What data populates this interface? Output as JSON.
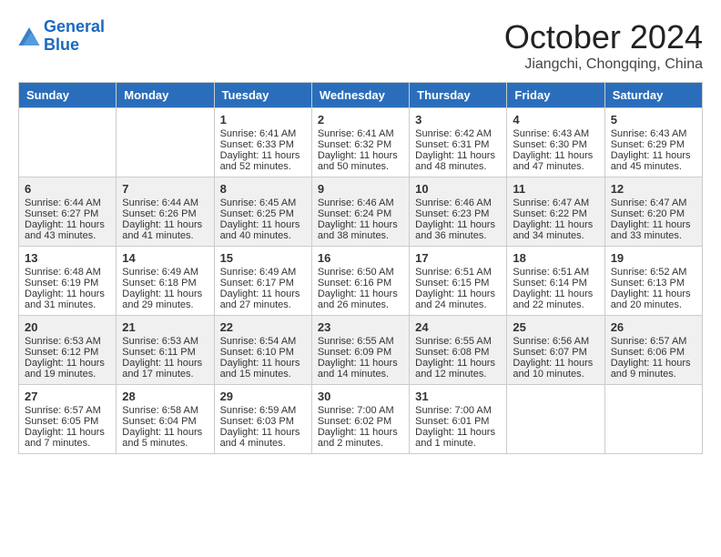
{
  "logo": {
    "line1": "General",
    "line2": "Blue"
  },
  "title": "October 2024",
  "location": "Jiangchi, Chongqing, China",
  "weekdays": [
    "Sunday",
    "Monday",
    "Tuesday",
    "Wednesday",
    "Thursday",
    "Friday",
    "Saturday"
  ],
  "weeks": [
    [
      {
        "day": "",
        "sunrise": "",
        "sunset": "",
        "daylight": ""
      },
      {
        "day": "",
        "sunrise": "",
        "sunset": "",
        "daylight": ""
      },
      {
        "day": "1",
        "sunrise": "Sunrise: 6:41 AM",
        "sunset": "Sunset: 6:33 PM",
        "daylight": "Daylight: 11 hours and 52 minutes."
      },
      {
        "day": "2",
        "sunrise": "Sunrise: 6:41 AM",
        "sunset": "Sunset: 6:32 PM",
        "daylight": "Daylight: 11 hours and 50 minutes."
      },
      {
        "day": "3",
        "sunrise": "Sunrise: 6:42 AM",
        "sunset": "Sunset: 6:31 PM",
        "daylight": "Daylight: 11 hours and 48 minutes."
      },
      {
        "day": "4",
        "sunrise": "Sunrise: 6:43 AM",
        "sunset": "Sunset: 6:30 PM",
        "daylight": "Daylight: 11 hours and 47 minutes."
      },
      {
        "day": "5",
        "sunrise": "Sunrise: 6:43 AM",
        "sunset": "Sunset: 6:29 PM",
        "daylight": "Daylight: 11 hours and 45 minutes."
      }
    ],
    [
      {
        "day": "6",
        "sunrise": "Sunrise: 6:44 AM",
        "sunset": "Sunset: 6:27 PM",
        "daylight": "Daylight: 11 hours and 43 minutes."
      },
      {
        "day": "7",
        "sunrise": "Sunrise: 6:44 AM",
        "sunset": "Sunset: 6:26 PM",
        "daylight": "Daylight: 11 hours and 41 minutes."
      },
      {
        "day": "8",
        "sunrise": "Sunrise: 6:45 AM",
        "sunset": "Sunset: 6:25 PM",
        "daylight": "Daylight: 11 hours and 40 minutes."
      },
      {
        "day": "9",
        "sunrise": "Sunrise: 6:46 AM",
        "sunset": "Sunset: 6:24 PM",
        "daylight": "Daylight: 11 hours and 38 minutes."
      },
      {
        "day": "10",
        "sunrise": "Sunrise: 6:46 AM",
        "sunset": "Sunset: 6:23 PM",
        "daylight": "Daylight: 11 hours and 36 minutes."
      },
      {
        "day": "11",
        "sunrise": "Sunrise: 6:47 AM",
        "sunset": "Sunset: 6:22 PM",
        "daylight": "Daylight: 11 hours and 34 minutes."
      },
      {
        "day": "12",
        "sunrise": "Sunrise: 6:47 AM",
        "sunset": "Sunset: 6:20 PM",
        "daylight": "Daylight: 11 hours and 33 minutes."
      }
    ],
    [
      {
        "day": "13",
        "sunrise": "Sunrise: 6:48 AM",
        "sunset": "Sunset: 6:19 PM",
        "daylight": "Daylight: 11 hours and 31 minutes."
      },
      {
        "day": "14",
        "sunrise": "Sunrise: 6:49 AM",
        "sunset": "Sunset: 6:18 PM",
        "daylight": "Daylight: 11 hours and 29 minutes."
      },
      {
        "day": "15",
        "sunrise": "Sunrise: 6:49 AM",
        "sunset": "Sunset: 6:17 PM",
        "daylight": "Daylight: 11 hours and 27 minutes."
      },
      {
        "day": "16",
        "sunrise": "Sunrise: 6:50 AM",
        "sunset": "Sunset: 6:16 PM",
        "daylight": "Daylight: 11 hours and 26 minutes."
      },
      {
        "day": "17",
        "sunrise": "Sunrise: 6:51 AM",
        "sunset": "Sunset: 6:15 PM",
        "daylight": "Daylight: 11 hours and 24 minutes."
      },
      {
        "day": "18",
        "sunrise": "Sunrise: 6:51 AM",
        "sunset": "Sunset: 6:14 PM",
        "daylight": "Daylight: 11 hours and 22 minutes."
      },
      {
        "day": "19",
        "sunrise": "Sunrise: 6:52 AM",
        "sunset": "Sunset: 6:13 PM",
        "daylight": "Daylight: 11 hours and 20 minutes."
      }
    ],
    [
      {
        "day": "20",
        "sunrise": "Sunrise: 6:53 AM",
        "sunset": "Sunset: 6:12 PM",
        "daylight": "Daylight: 11 hours and 19 minutes."
      },
      {
        "day": "21",
        "sunrise": "Sunrise: 6:53 AM",
        "sunset": "Sunset: 6:11 PM",
        "daylight": "Daylight: 11 hours and 17 minutes."
      },
      {
        "day": "22",
        "sunrise": "Sunrise: 6:54 AM",
        "sunset": "Sunset: 6:10 PM",
        "daylight": "Daylight: 11 hours and 15 minutes."
      },
      {
        "day": "23",
        "sunrise": "Sunrise: 6:55 AM",
        "sunset": "Sunset: 6:09 PM",
        "daylight": "Daylight: 11 hours and 14 minutes."
      },
      {
        "day": "24",
        "sunrise": "Sunrise: 6:55 AM",
        "sunset": "Sunset: 6:08 PM",
        "daylight": "Daylight: 11 hours and 12 minutes."
      },
      {
        "day": "25",
        "sunrise": "Sunrise: 6:56 AM",
        "sunset": "Sunset: 6:07 PM",
        "daylight": "Daylight: 11 hours and 10 minutes."
      },
      {
        "day": "26",
        "sunrise": "Sunrise: 6:57 AM",
        "sunset": "Sunset: 6:06 PM",
        "daylight": "Daylight: 11 hours and 9 minutes."
      }
    ],
    [
      {
        "day": "27",
        "sunrise": "Sunrise: 6:57 AM",
        "sunset": "Sunset: 6:05 PM",
        "daylight": "Daylight: 11 hours and 7 minutes."
      },
      {
        "day": "28",
        "sunrise": "Sunrise: 6:58 AM",
        "sunset": "Sunset: 6:04 PM",
        "daylight": "Daylight: 11 hours and 5 minutes."
      },
      {
        "day": "29",
        "sunrise": "Sunrise: 6:59 AM",
        "sunset": "Sunset: 6:03 PM",
        "daylight": "Daylight: 11 hours and 4 minutes."
      },
      {
        "day": "30",
        "sunrise": "Sunrise: 7:00 AM",
        "sunset": "Sunset: 6:02 PM",
        "daylight": "Daylight: 11 hours and 2 minutes."
      },
      {
        "day": "31",
        "sunrise": "Sunrise: 7:00 AM",
        "sunset": "Sunset: 6:01 PM",
        "daylight": "Daylight: 11 hours and 1 minute."
      },
      {
        "day": "",
        "sunrise": "",
        "sunset": "",
        "daylight": ""
      },
      {
        "day": "",
        "sunrise": "",
        "sunset": "",
        "daylight": ""
      }
    ]
  ]
}
